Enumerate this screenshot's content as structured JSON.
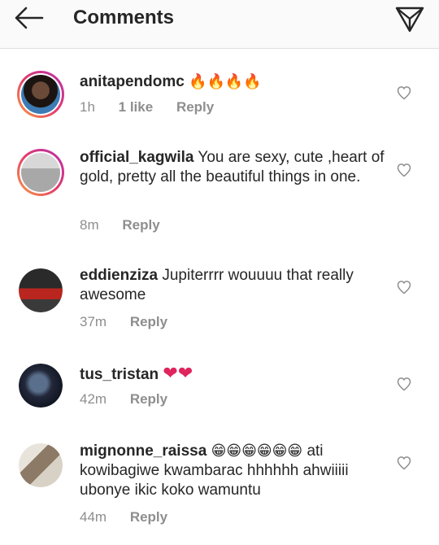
{
  "header": {
    "title": "Comments",
    "back_icon": "arrow-left-icon",
    "send_icon": "paper-plane-icon"
  },
  "comments": [
    {
      "username": "anitapendomc",
      "text": "",
      "emoji": "🔥🔥🔥🔥",
      "time": "1h",
      "likes": "1 like",
      "reply": "Reply",
      "story_ring": true
    },
    {
      "username": "official_kagwila",
      "text": "You  are sexy, cute ,heart of gold, pretty all the beautiful things in one.",
      "time": "8m",
      "reply": "Reply",
      "story_ring": true
    },
    {
      "username": "eddienziza",
      "text": "Jupiterrrr wouuuu that really awesome",
      "time": "37m",
      "reply": "Reply",
      "story_ring": false
    },
    {
      "username": "tus_tristan",
      "text": "",
      "emoji": "❤❤",
      "time": "42m",
      "reply": "Reply",
      "story_ring": false
    },
    {
      "username": "mignonne_raissa",
      "text_before": "",
      "emoji": "😁😁😁😁😁😁",
      "text": "ati kowibagiwe kwambarac hhhhhh ahwiiiii ubonye ikic koko wamuntu",
      "time": "44m",
      "reply": "Reply",
      "story_ring": false
    }
  ],
  "colors": {
    "text": "#262626",
    "muted": "#8e8e8e",
    "ring_start": "#f9a03f",
    "ring_end": "#b62fae",
    "heart": "#e0245e"
  }
}
